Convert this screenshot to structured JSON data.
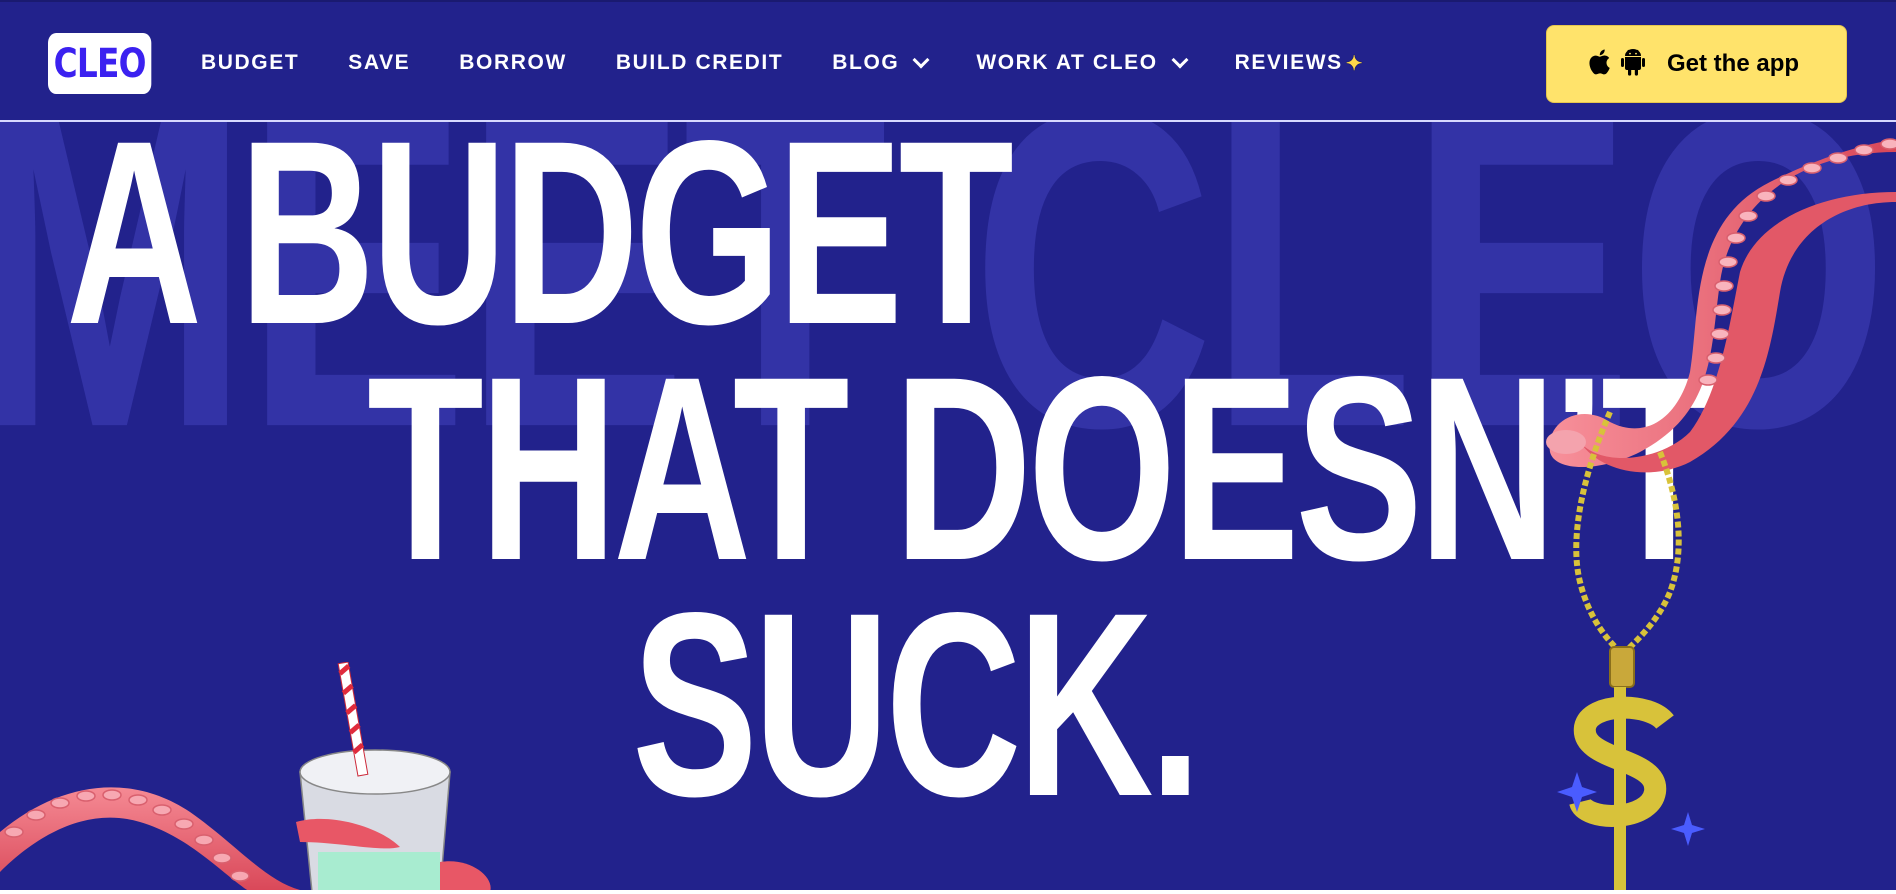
{
  "brand": {
    "logo_text": "CLEO"
  },
  "nav": {
    "items": [
      {
        "label": "BUDGET",
        "has_dropdown": false
      },
      {
        "label": "SAVE",
        "has_dropdown": false
      },
      {
        "label": "BORROW",
        "has_dropdown": false
      },
      {
        "label": "BUILD CREDIT",
        "has_dropdown": false
      },
      {
        "label": "BLOG",
        "has_dropdown": true
      },
      {
        "label": "WORK AT CLEO",
        "has_dropdown": true
      },
      {
        "label": "REVIEWS",
        "has_dropdown": false,
        "icon": "sparkle-icon"
      }
    ],
    "cta": {
      "label": "Get the app",
      "icons": [
        "apple-icon",
        "android-icon"
      ]
    }
  },
  "hero": {
    "background_word": "MEET CLEO",
    "headline": {
      "line1": "A BUDGET",
      "line2": "THAT DOESN’T",
      "line3": "SUCK."
    }
  },
  "colors": {
    "background": "#22228c",
    "background_text": "#3333a6",
    "cta_background": "#ffe36b",
    "logo_text": "#3b21f0",
    "tentacle": "#f06a78",
    "gold": "#d8c23a"
  }
}
